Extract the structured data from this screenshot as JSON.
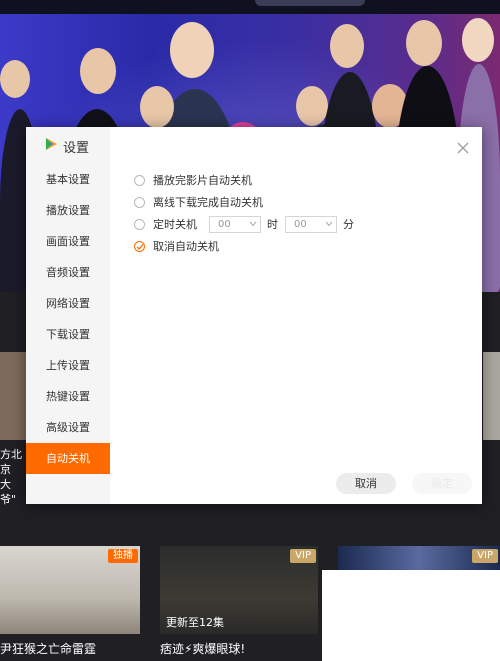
{
  "settings": {
    "title": "设置",
    "nav": [
      {
        "label": "基本设置"
      },
      {
        "label": "播放设置"
      },
      {
        "label": "画面设置"
      },
      {
        "label": "音频设置"
      },
      {
        "label": "网络设置"
      },
      {
        "label": "下载设置"
      },
      {
        "label": "上传设置"
      },
      {
        "label": "热键设置"
      },
      {
        "label": "高级设置"
      },
      {
        "label": "自动关机"
      }
    ],
    "active_nav": "自动关机",
    "options": {
      "after_playback": "播放完影片自动关机",
      "after_download": "离线下载完成自动关机",
      "timed": "定时关机",
      "hour_value": "00",
      "hour_unit": "时",
      "minute_value": "00",
      "minute_unit": "分",
      "cancel_auto": "取消自动关机",
      "selected": "取消自动关机"
    },
    "buttons": {
      "cancel": "取消",
      "ok": "确定"
    }
  },
  "background": {
    "left_caption_line1": "方北京",
    "left_caption_line2": "大爷\"",
    "cards": [
      {
        "badge": "独播",
        "caption": "尹狂猴之亡命雷霆"
      },
      {
        "badge": "VIP",
        "overlay": "更新至12集",
        "caption": "痞迹⚡爽爆眼球!"
      },
      {
        "badge": "VIP"
      }
    ]
  },
  "colors": {
    "accent": "#ff6a00",
    "sidebar_bg": "#f5f5f5",
    "page_bg": "#1f1f24"
  }
}
